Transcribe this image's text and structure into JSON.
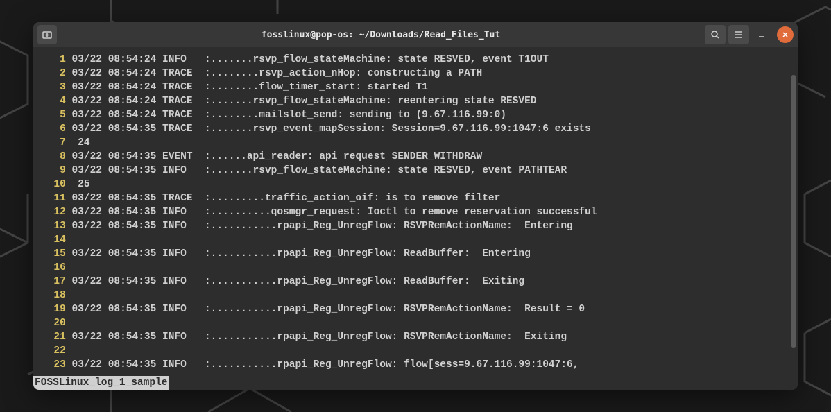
{
  "window": {
    "title": "fosslinux@pop-os: ~/Downloads/Read_Files_Tut"
  },
  "status_bar": "FOSSLinux_log_1_sample",
  "log_lines": [
    {
      "num": "1",
      "text": " 03/22 08:54:24 INFO   :.......rsvp_flow_stateMachine: state RESVED, event T1OUT"
    },
    {
      "num": "2",
      "text": " 03/22 08:54:24 TRACE  :........rsvp_action_nHop: constructing a PATH"
    },
    {
      "num": "3",
      "text": " 03/22 08:54:24 TRACE  :........flow_timer_start: started T1"
    },
    {
      "num": "4",
      "text": " 03/22 08:54:24 TRACE  :.......rsvp_flow_stateMachine: reentering state RESVED"
    },
    {
      "num": "5",
      "text": " 03/22 08:54:24 TRACE  :........mailslot_send: sending to (9.67.116.99:0)"
    },
    {
      "num": "6",
      "text": " 03/22 08:54:35 TRACE  :.......rsvp_event_mapSession: Session=9.67.116.99:1047:6 exists"
    },
    {
      "num": "7",
      "text": "  24"
    },
    {
      "num": "8",
      "text": " 03/22 08:54:35 EVENT  :......api_reader: api request SENDER_WITHDRAW"
    },
    {
      "num": "9",
      "text": " 03/22 08:54:35 INFO   :.......rsvp_flow_stateMachine: state RESVED, event PATHTEAR"
    },
    {
      "num": "10",
      "text": "  25"
    },
    {
      "num": "11",
      "text": " 03/22 08:54:35 TRACE  :.........traffic_action_oif: is to remove filter"
    },
    {
      "num": "12",
      "text": " 03/22 08:54:35 INFO   :..........qosmgr_request: Ioctl to remove reservation successful"
    },
    {
      "num": "13",
      "text": " 03/22 08:54:35 INFO   :...........rpapi_Reg_UnregFlow: RSVPRemActionName:  Entering"
    },
    {
      "num": "14",
      "text": ""
    },
    {
      "num": "15",
      "text": " 03/22 08:54:35 INFO   :...........rpapi_Reg_UnregFlow: ReadBuffer:  Entering"
    },
    {
      "num": "16",
      "text": ""
    },
    {
      "num": "17",
      "text": " 03/22 08:54:35 INFO   :...........rpapi_Reg_UnregFlow: ReadBuffer:  Exiting"
    },
    {
      "num": "18",
      "text": ""
    },
    {
      "num": "19",
      "text": " 03/22 08:54:35 INFO   :...........rpapi_Reg_UnregFlow: RSVPRemActionName:  Result = 0"
    },
    {
      "num": "20",
      "text": ""
    },
    {
      "num": "21",
      "text": " 03/22 08:54:35 INFO   :...........rpapi_Reg_UnregFlow: RSVPRemActionName:  Exiting"
    },
    {
      "num": "22",
      "text": ""
    },
    {
      "num": "23",
      "text": " 03/22 08:54:35 INFO   :...........rpapi_Reg_UnregFlow: flow[sess=9.67.116.99:1047:6,"
    }
  ]
}
